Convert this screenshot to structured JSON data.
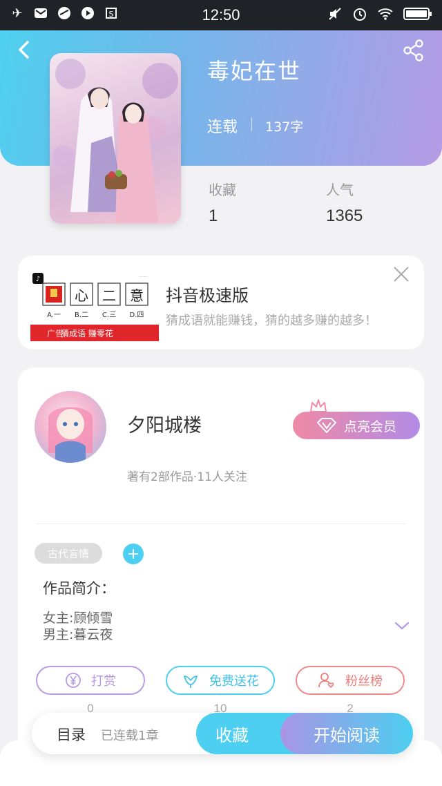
{
  "status_bar": {
    "time": "12:50"
  },
  "book": {
    "title": "毒妃在世",
    "status": "连载",
    "word_count": "137字",
    "stats": [
      {
        "label": "收藏",
        "value": "1"
      },
      {
        "label": "人气",
        "value": "1365"
      }
    ]
  },
  "ad": {
    "title": "抖音极速版",
    "description": "猜成语就能赚钱，猜的越多赚的越多！",
    "tiles": [
      "心",
      "二",
      "意"
    ],
    "options": [
      "A.一",
      "B.二",
      "C.三",
      "D.四"
    ],
    "banner": "猜成语  赚零花",
    "badge": "广告"
  },
  "author": {
    "name": "夕阳城楼",
    "info": "著有2部作品·11人关注",
    "vip_label": "点亮会员"
  },
  "details": {
    "tag": "古代言情",
    "intro_label": "作品简介：",
    "intro_lines": [
      "女主:顾倾雪",
      "男主:暮云夜"
    ]
  },
  "actions": [
    {
      "label": "打赏",
      "count": "0",
      "color": "#b89be6"
    },
    {
      "label": "免费送花",
      "count": "10",
      "color": "#4ccff0"
    },
    {
      "label": "粉丝榜",
      "count": "2",
      "color": "#f08a8a"
    }
  ],
  "bottom_bar": {
    "toc_label": "目录",
    "chapters": "已连载1章",
    "favorite_label": "收藏",
    "read_label": "开始阅读"
  }
}
